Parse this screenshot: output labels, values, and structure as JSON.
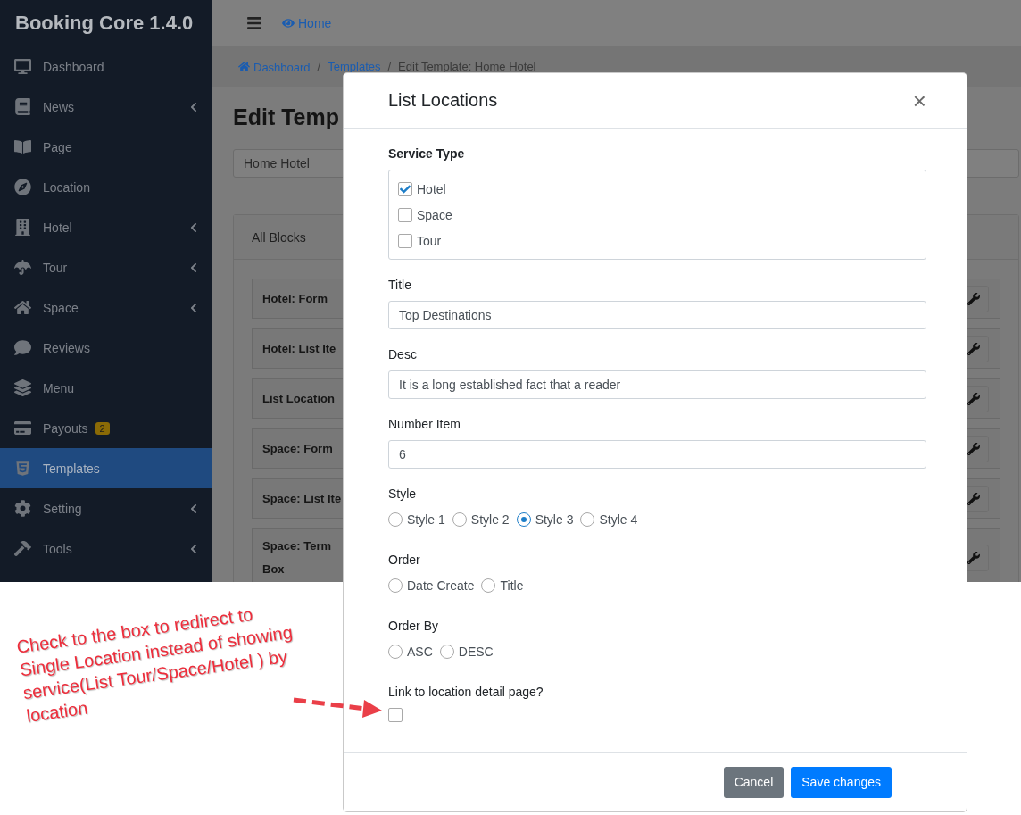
{
  "sidebar": {
    "brand": "Booking Core 1.4.0",
    "items": [
      {
        "label": "Dashboard",
        "expandable": false,
        "selected": false
      },
      {
        "label": "News",
        "expandable": true,
        "selected": false
      },
      {
        "label": "Page",
        "expandable": false,
        "selected": false
      },
      {
        "label": "Location",
        "expandable": false,
        "selected": false
      },
      {
        "label": "Hotel",
        "expandable": true,
        "selected": false
      },
      {
        "label": "Tour",
        "expandable": true,
        "selected": false
      },
      {
        "label": "Space",
        "expandable": true,
        "selected": false
      },
      {
        "label": "Reviews",
        "expandable": false,
        "selected": false
      },
      {
        "label": "Menu",
        "expandable": false,
        "selected": false
      },
      {
        "label": "Payouts",
        "badge": "2",
        "expandable": false,
        "selected": false
      },
      {
        "label": "Templates",
        "expandable": false,
        "selected": true
      },
      {
        "label": "Setting",
        "expandable": true,
        "selected": false
      },
      {
        "label": "Tools",
        "expandable": true,
        "selected": false
      }
    ]
  },
  "topbar": {
    "home_link": "Home"
  },
  "breadcrumb": [
    {
      "kind": "link",
      "label": "Dashboard"
    },
    {
      "kind": "separator",
      "label": "/"
    },
    {
      "kind": "link",
      "label": "Templates"
    },
    {
      "kind": "separator",
      "label": "/"
    },
    {
      "kind": "current",
      "label": "Edit Template: Home Hotel"
    }
  ],
  "page": {
    "heading": "Edit Temp",
    "name_field": "Home Hotel",
    "blocks_tab": "All Blocks",
    "blocks": [
      {
        "title": "Hotel: Form"
      },
      {
        "title": "Hotel: List Ite"
      },
      {
        "title": "List Location"
      },
      {
        "title": "Space: Form"
      },
      {
        "title": "Space: List Ite"
      },
      {
        "title": "Space: Term",
        "title_continued": "Box"
      }
    ]
  },
  "modal": {
    "title": "List Locations",
    "close": "×",
    "fields": [
      {
        "kind": "checklist",
        "label": "Service Type",
        "strong": true,
        "options": [
          {
            "label": "Hotel",
            "checked": true
          },
          {
            "label": "Space",
            "checked": false
          },
          {
            "label": "Tour",
            "checked": false
          }
        ]
      },
      {
        "kind": "text",
        "label": "Title",
        "strong": false,
        "value": "Top Destinations"
      },
      {
        "kind": "text",
        "label": "Desc",
        "strong": false,
        "value": "It is a long established fact that a reader"
      },
      {
        "kind": "text",
        "label": "Number Item",
        "strong": false,
        "value": "6"
      },
      {
        "kind": "radio",
        "label": "Style",
        "strong": false,
        "options": [
          {
            "label": "Style 1",
            "selected": false
          },
          {
            "label": "Style 2",
            "selected": false
          },
          {
            "label": "Style 3",
            "selected": true
          },
          {
            "label": "Style 4",
            "selected": false
          }
        ]
      },
      {
        "kind": "radio",
        "label": "Order",
        "strong": false,
        "options": [
          {
            "label": "Date Create",
            "selected": false
          },
          {
            "label": "Title",
            "selected": false
          }
        ]
      },
      {
        "kind": "radio",
        "label": "Order By",
        "strong": false,
        "options": [
          {
            "label": "ASC",
            "selected": false
          },
          {
            "label": "DESC",
            "selected": false
          }
        ]
      },
      {
        "kind": "checkbox",
        "label": "Link to location detail page?",
        "strong": false,
        "checked": false
      }
    ],
    "buttons": [
      {
        "kind": "secondary",
        "label": "Cancel"
      },
      {
        "kind": "primary",
        "label": "Save changes"
      }
    ]
  },
  "annotation": {
    "lines": [
      "Check to the box to redirect to",
      "Single Location instead of showing",
      "service(List Tour/Space/Hotel ) by",
      "location"
    ]
  }
}
